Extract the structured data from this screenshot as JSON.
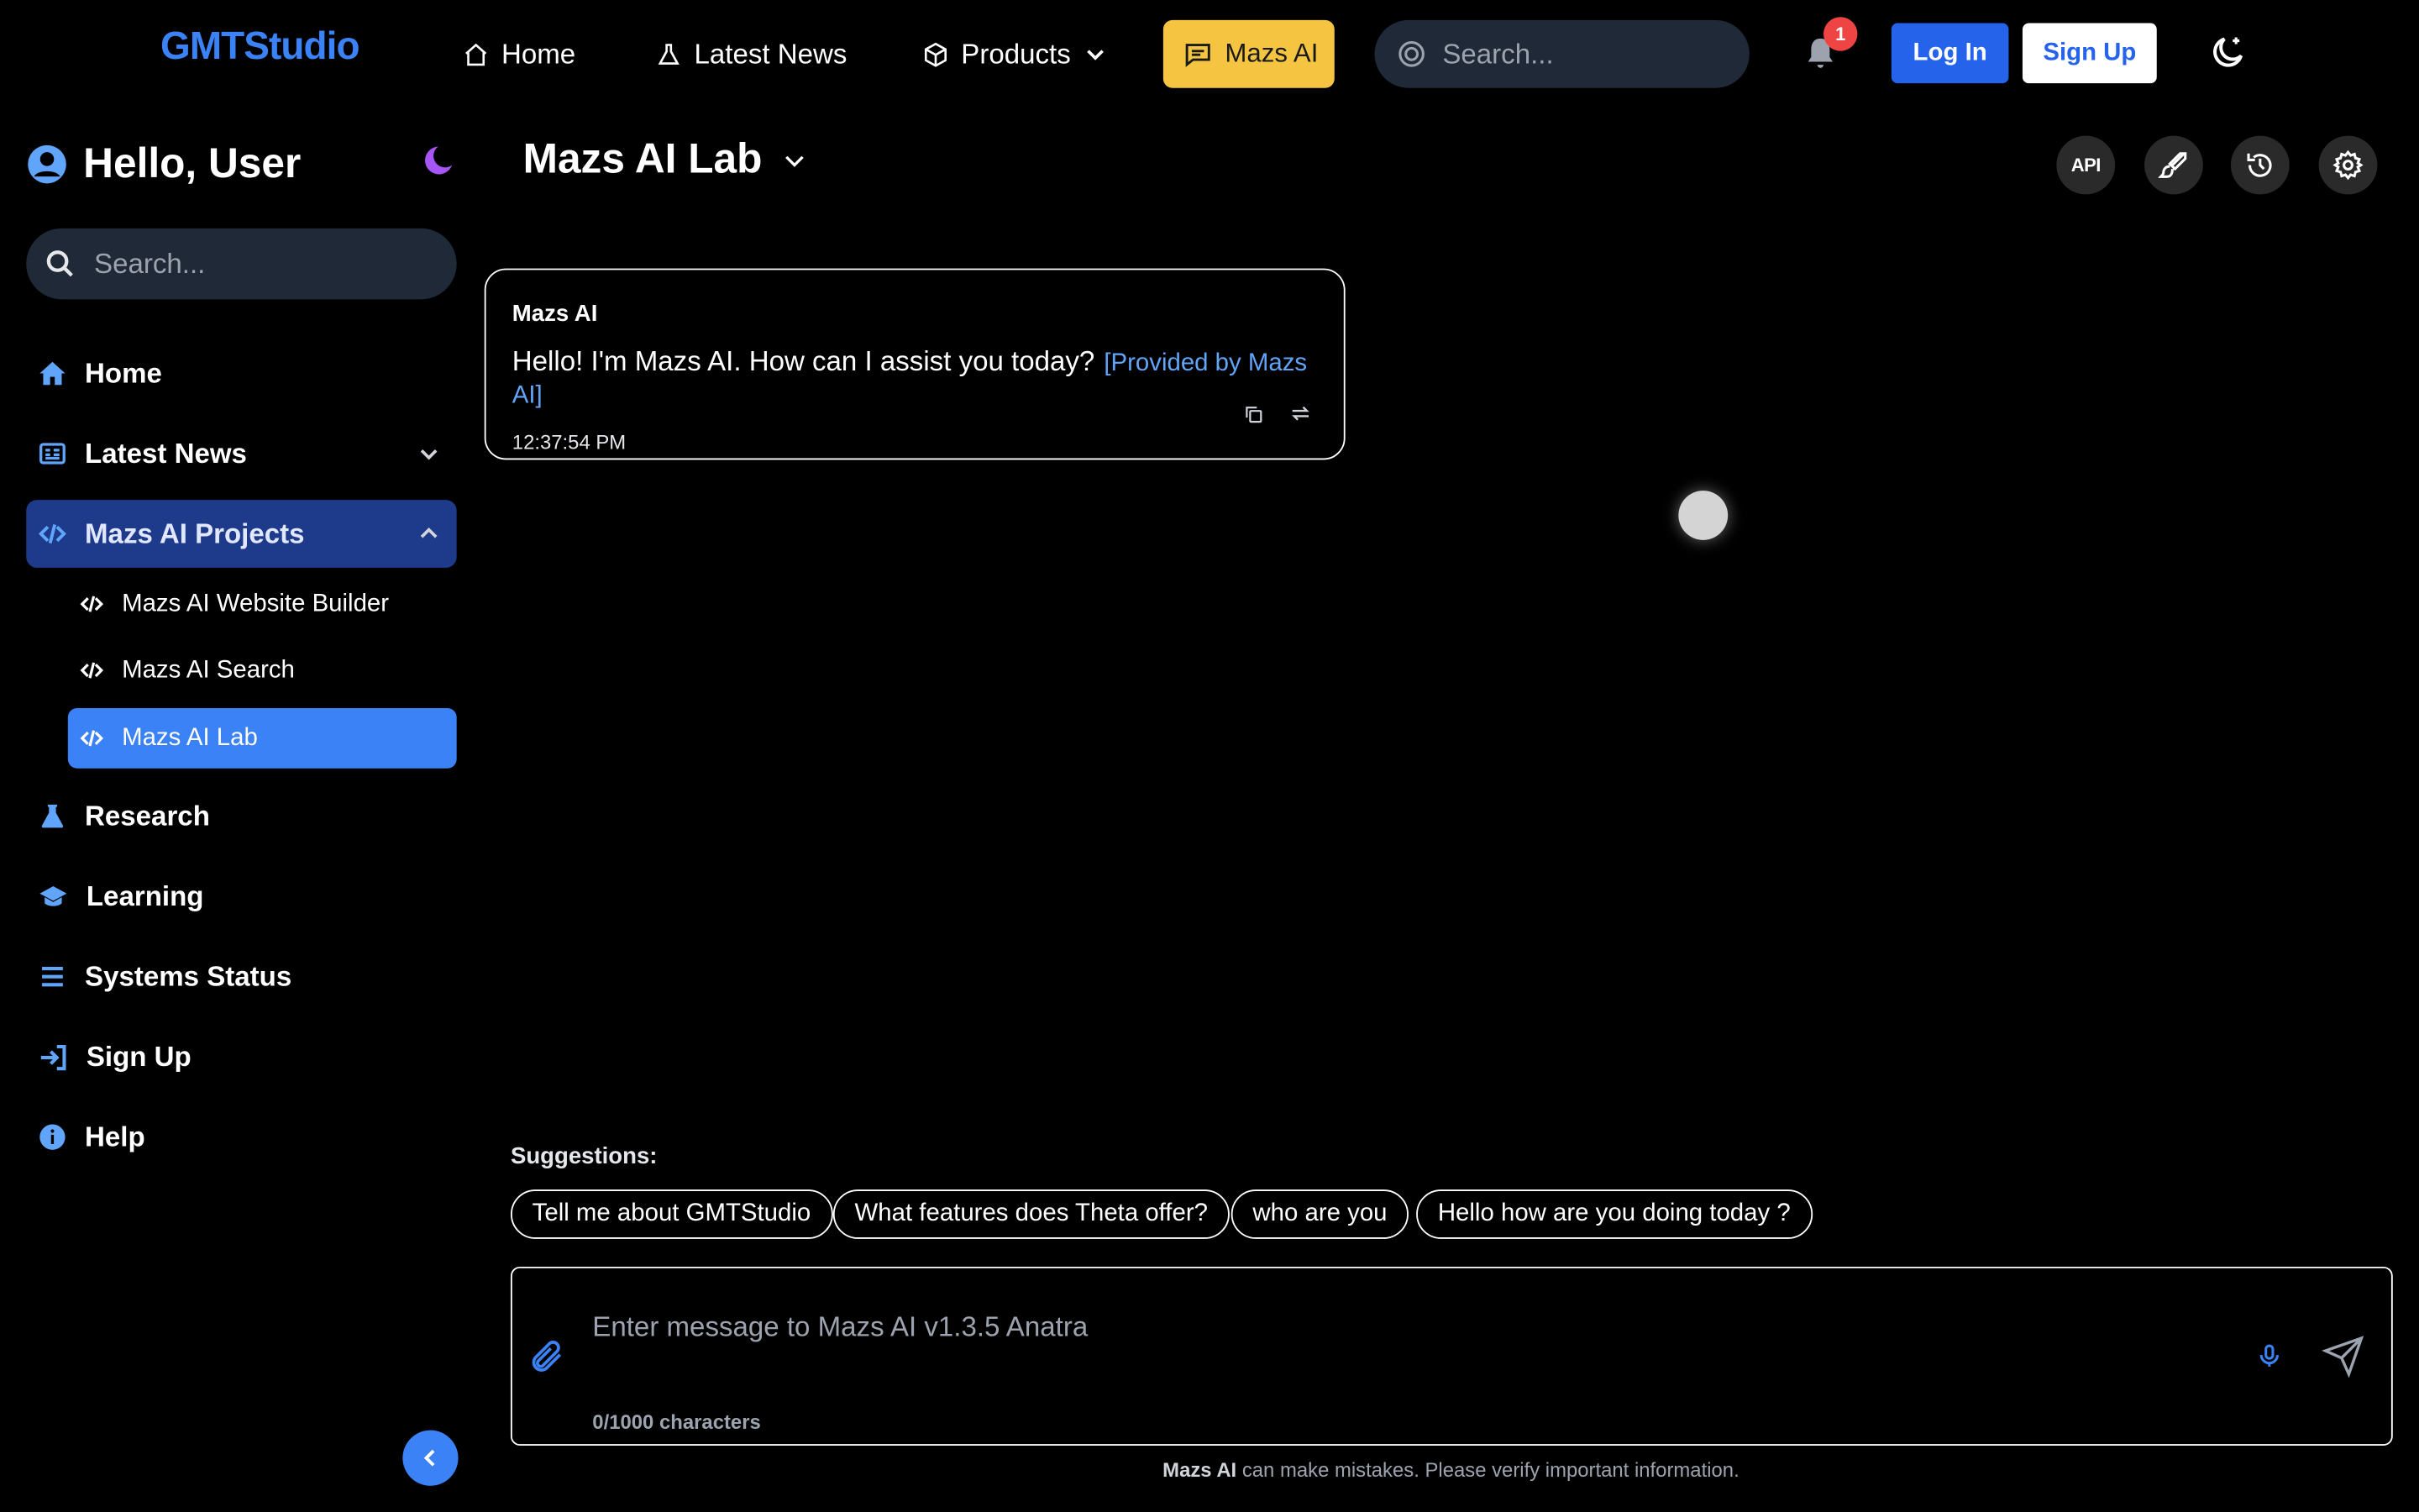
{
  "topnav": {
    "logo": "GMTStudio",
    "links": [
      "Home",
      "Latest News",
      "Products"
    ],
    "mazs_ai_button": "Mazs AI",
    "search_placeholder": "Search...",
    "notification_count": "1",
    "login_label": "Log In",
    "signup_label": "Sign Up",
    "icons": [
      "home-icon",
      "flask-icon",
      "cube-icon",
      "chevron-down-icon",
      "chat-icon",
      "search-icon",
      "bell-icon",
      "moon-stars-icon"
    ]
  },
  "sidebar": {
    "greeting": "Hello, User",
    "search_placeholder": "Search...",
    "items": [
      {
        "label": "Home",
        "icon": "home-icon"
      },
      {
        "label": "Latest News",
        "icon": "newspaper-icon"
      },
      {
        "label": "Mazs AI Projects",
        "icon": "code-icon"
      },
      {
        "label": "Research",
        "icon": "flask-icon"
      },
      {
        "label": "Learning",
        "icon": "graduation-cap-icon"
      },
      {
        "label": "Systems Status",
        "icon": "list-icon"
      },
      {
        "label": "Sign Up",
        "icon": "sign-in-icon"
      },
      {
        "label": "Help",
        "icon": "info-icon"
      }
    ],
    "sub_items": [
      {
        "label": "Mazs AI Website Builder",
        "icon": "code-icon"
      },
      {
        "label": "Mazs AI Search",
        "icon": "code-icon"
      },
      {
        "label": "Mazs AI Lab",
        "icon": "code-icon"
      }
    ],
    "active_sub_item": "Mazs AI Lab"
  },
  "main": {
    "title": "Mazs AI Lab",
    "toolbar": {
      "api_label": "API",
      "icons": [
        "api-icon",
        "brush-icon",
        "history-icon",
        "gear-icon"
      ]
    },
    "messages": [
      {
        "sender": "Mazs AI",
        "text": "Hello! I'm Mazs AI. How can I assist you today?",
        "provider": "[Provided by Mazs AI]",
        "time": "12:37:54 PM"
      }
    ],
    "suggestions_label": "Suggestions:",
    "suggestions": [
      "Tell me about GMTStudio",
      "What features does Theta offer?",
      "who are you",
      "Hello how are you doing today ?"
    ],
    "composer": {
      "placeholder": "Enter message to Mazs AI v1.3.5 Anatra",
      "char_count": "0/1000 characters"
    },
    "disclaimer_brand": "Mazs AI",
    "disclaimer_text": " can make mistakes. Please verify important information."
  },
  "colors": {
    "accent": "#3b82f6",
    "brand_yellow": "#f5c542",
    "active_nav": "#1e3a8a",
    "background": "#000000"
  }
}
